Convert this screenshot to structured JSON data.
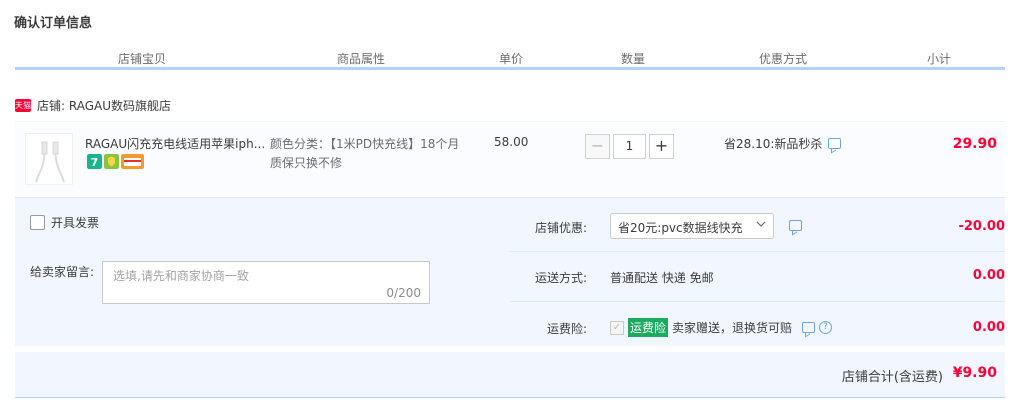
{
  "page": {
    "title": "确认订单信息"
  },
  "columns": [
    "店铺宝贝",
    "商品属性",
    "单价",
    "数量",
    "优惠方式",
    "小计"
  ],
  "shop": {
    "badge": "天猫",
    "label": "店铺: RAGAU数码旗舰店"
  },
  "item": {
    "title": "RAGAU闪充充电线适用苹果iph...",
    "attribute": "颜色分类：【1米PD快充线】18个月质保只换不修",
    "price": "58.00",
    "quantity": "1",
    "minus": "−",
    "plus": "+",
    "discount": "省28.10:新品秒杀",
    "subtotal": "29.90",
    "service_icons": [
      "seven-day-return-icon",
      "shield-guarantee-icon",
      "credit-card-icon"
    ]
  },
  "options": {
    "invoice_label": "开具发票",
    "remark_label": "给卖家留言:",
    "remark_placeholder": "选填,请先和商家协商一致",
    "remark_count": "0/200",
    "shop_discount_label": "店铺优惠:",
    "shop_discount_value": "省20元:pvc数据线快充",
    "shop_discount_amount": "-20.00",
    "shipping_label": "运送方式:",
    "shipping_value": "普通配送 快递 免邮",
    "shipping_amount": "0.00",
    "insurance_label": "运费险:",
    "insurance_tag": "运费险",
    "insurance_text": "卖家赠送，退换货可赔",
    "insurance_amount": "0.00"
  },
  "total": {
    "label": "店铺合计(含运费)",
    "amount": "¥9.90"
  },
  "colors": {
    "accent": "#ff0036",
    "header_line": "#b2d1ff",
    "panel_bg": "#f2f7ff",
    "insurance_green": "#1aab5f"
  }
}
